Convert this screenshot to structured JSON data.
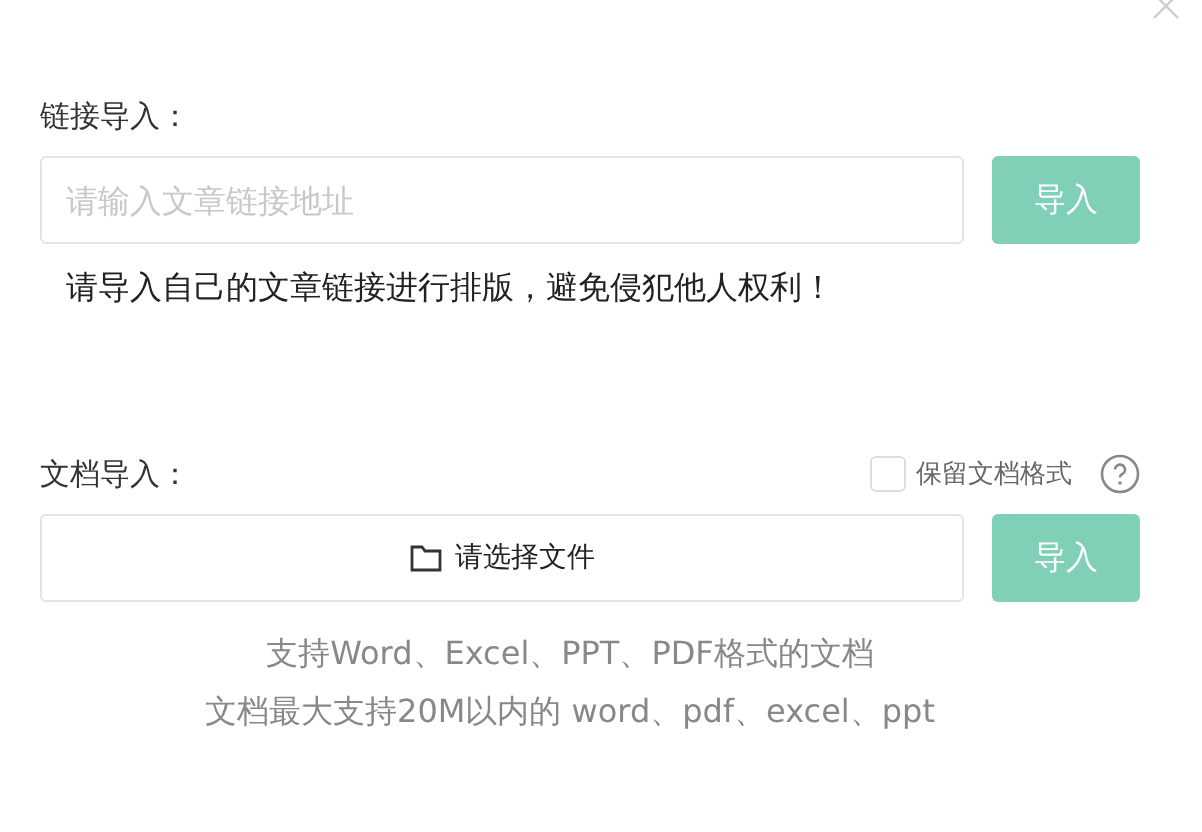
{
  "link_import": {
    "label": "链接导入：",
    "placeholder": "请输入文章链接地址",
    "button": "导入",
    "note": "请导入自己的文章链接进行排版，避免侵犯他人权利！"
  },
  "doc_import": {
    "label": "文档导入：",
    "keep_format": {
      "label": "保留文档格式",
      "checked": false
    },
    "file_picker": "请选择文件",
    "button": "导入",
    "hints": [
      "支持Word、Excel、PPT、PDF格式的文档",
      "文档最大支持20M以内的 word、pdf、excel、ppt"
    ]
  }
}
